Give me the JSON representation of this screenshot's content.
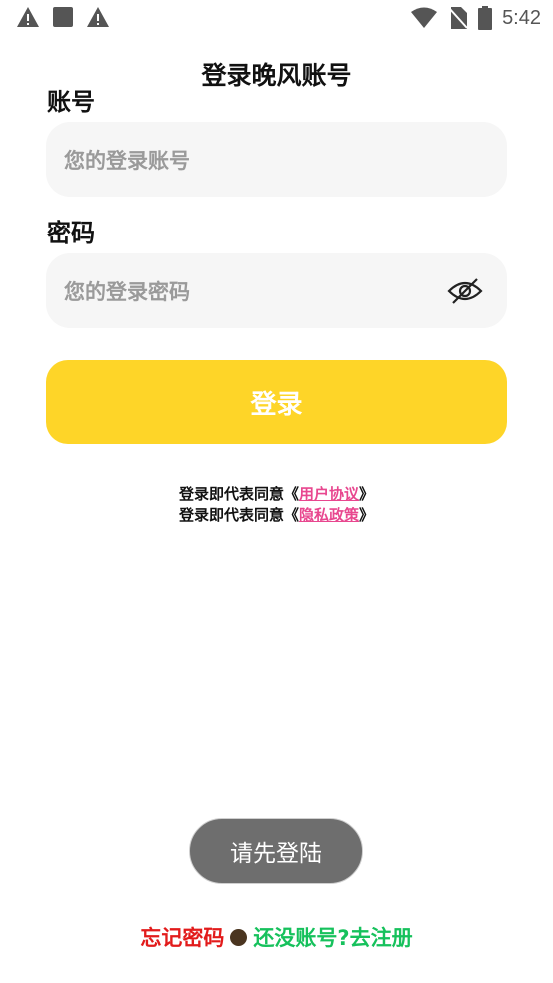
{
  "status_bar": {
    "time": "5:42",
    "left_icons": [
      "warning-icon",
      "square-icon",
      "warning-icon"
    ],
    "right_icons": [
      "wifi-icon",
      "no-sim-icon",
      "battery-icon"
    ]
  },
  "header": {
    "title": "登录晚风账号"
  },
  "form": {
    "account": {
      "label": "账号",
      "placeholder": "您的登录账号",
      "value": ""
    },
    "password": {
      "label": "密码",
      "placeholder": "您的登录密码",
      "value": "",
      "toggle_icon": "eye-off-icon"
    },
    "submit_label": "登录"
  },
  "agreements": {
    "prefix": "登录即代表同意",
    "open_quote": "《",
    "close_quote": "》",
    "user_agreement": "用户协议",
    "privacy_policy": "隐私政策"
  },
  "toast": {
    "text": "请先登陆"
  },
  "footer": {
    "forgot_password": "忘记密码",
    "register": "还没账号?去注册"
  },
  "colors": {
    "primary_button": "#fed528",
    "link_pink": "#e8478f",
    "forgot_red": "#e21b1b",
    "register_green": "#16c15c",
    "field_bg": "#f6f6f6"
  }
}
